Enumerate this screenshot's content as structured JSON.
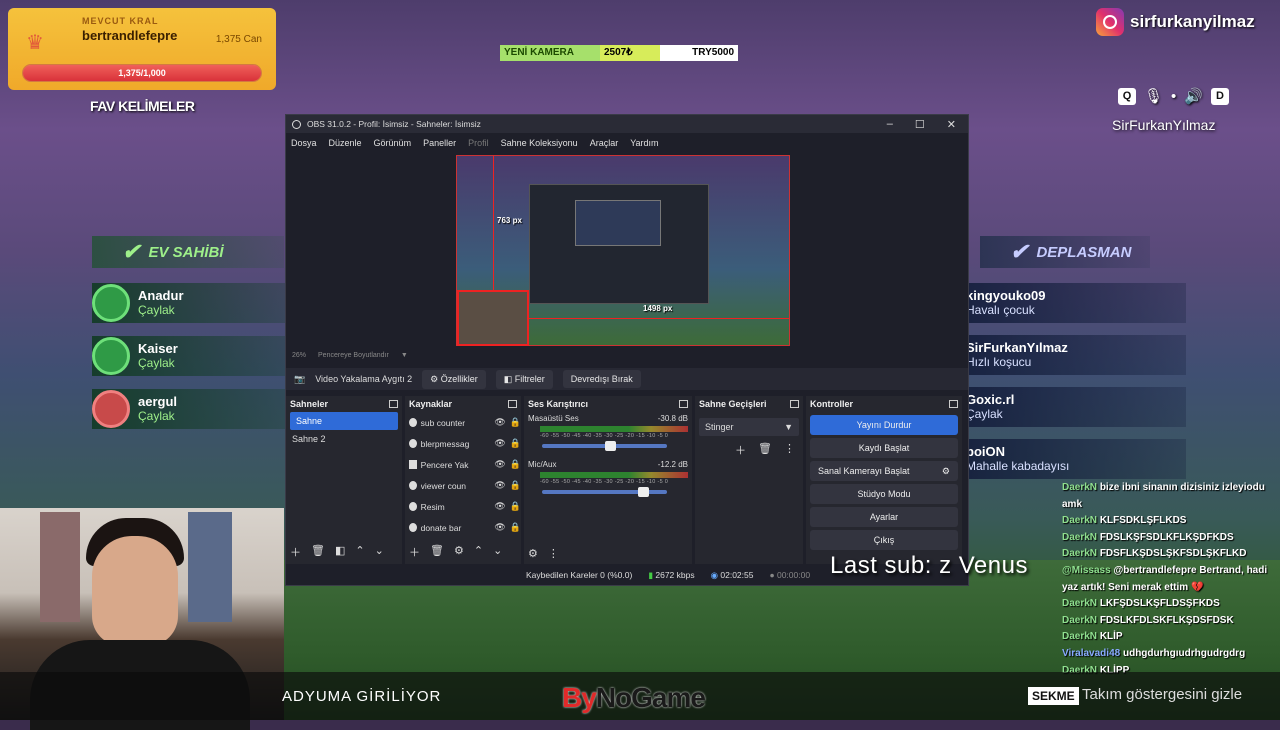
{
  "king": {
    "label": "MEVCUT KRAL",
    "name": "bertrandlefepre",
    "health": "1,375 Can",
    "progress_text": "1,375/1,000",
    "progress_fraction": 1.0
  },
  "fav_words": "FAV KELİMELER",
  "ticker": {
    "label": "YENİ KAMERA",
    "current": "2507₺",
    "target": "TRY5000"
  },
  "instagram": {
    "handle": "sirfurkanyilmaz",
    "icon": "instagram-icon"
  },
  "overlay_keys": [
    "Q",
    "D"
  ],
  "overlay_name": "SirFurkanYılmaz",
  "home_team": {
    "title": "EV SAHİBİ",
    "players": [
      {
        "name": "Anadur",
        "rank": "Çaylak"
      },
      {
        "name": "Kaiser",
        "rank": "Çaylak"
      },
      {
        "name": "aergul",
        "rank": "Çaylak"
      }
    ]
  },
  "away_team": {
    "title": "DEPLASMAN",
    "players": [
      {
        "name": "kingyouko09",
        "rank": "Havalı çocuk"
      },
      {
        "name": "SirFurkanYılmaz",
        "rank": "Hızlı koşucu"
      },
      {
        "name": "Goxic.rl",
        "rank": "Çaylak"
      },
      {
        "name": "boiON",
        "rank": "Mahalle kabadayısı"
      }
    ]
  },
  "obs": {
    "title": "OBS 31.0.2 - Profil: İsimsiz - Sahneler: İsimsiz",
    "menu": [
      "Dosya",
      "Düzenle",
      "Görünüm",
      "Paneller",
      "Profil",
      "Sahne Koleksiyonu",
      "Araçlar",
      "Yardım"
    ],
    "preview": {
      "width_label": "763 px",
      "height_label": "1498 px",
      "zoom": "26%",
      "fit": "Pencereye Boyutlandır"
    },
    "source_bar": {
      "source": "Video Yakalama Aygıtı 2",
      "props": "Özellikler",
      "filters": "Filtreler",
      "deactivate": "Devredışı Bırak"
    },
    "docks": {
      "scenes_title": "Sahneler",
      "scenes": [
        "Sahne",
        "Sahne 2"
      ],
      "sources_title": "Kaynaklar",
      "sources": [
        "sub counter",
        "blerpmessag",
        "Pencere Yak",
        "viewer coun",
        "Resim",
        "donate bar"
      ],
      "mixer_title": "Ses Karıştırıcı",
      "channels": [
        {
          "name": "Masaüstü Ses",
          "db": "-30.8 dB",
          "level": 0.55
        },
        {
          "name": "Mic/Aux",
          "db": "-12.2 dB",
          "level": 0.82
        }
      ],
      "meter_scale": "-60 -55 -50 -45 -40 -35 -30 -25 -20 -15 -10 -5 0",
      "transitions_title": "Sahne Geçişleri",
      "transition": "Stinger",
      "controls_title": "Kontroller",
      "controls": [
        "Yayını Durdur",
        "Kaydı Başlat",
        "Sanal Kamerayı Başlat",
        "Stüdyo Modu",
        "Ayarlar",
        "Çıkış"
      ]
    },
    "status": {
      "dropped": "Kaybedilen Kareler 0 (%0.0)",
      "bitrate": "2672 kbps",
      "live_time": "02:02:55",
      "rec_time": "00:00:00"
    }
  },
  "last_sub": "Last sub: z Venus",
  "chat": [
    {
      "user": "DaerkN",
      "msg": "bize ibni sinanın dizisiniz izleyiodu amk"
    },
    {
      "user": "DaerkN",
      "msg": "KLFSDKLŞFLKDS"
    },
    {
      "user": "DaerkN",
      "msg": "FDSLKŞFSDLKFLKŞDFKDS"
    },
    {
      "user": "DaerkN",
      "msg": "FDSFLKŞDSLŞKFSDLŞKFLKD"
    },
    {
      "user": "@Missass",
      "msg": "@bertrandlefepre Bertrand, hadi yaz artık! Seni merak ettim 💔"
    },
    {
      "user": "DaerkN",
      "msg": "LKFŞDSLKŞFLDSŞFKDS"
    },
    {
      "user": "DaerkN",
      "msg": "FDSLKFDLSKFLKŞDSFDSK"
    },
    {
      "user": "DaerkN",
      "msg": "KLİP"
    },
    {
      "user": "Viralavadi48",
      "msg": "udhgdurhgıudrhgudrgdrg"
    },
    {
      "user": "DaerkN",
      "msg": "KLİPP"
    }
  ],
  "bottom": {
    "stadium": "ADYUMA GİRİLİYOR",
    "logo_a": "By",
    "logo_b": "NoGame",
    "key": "SEKME",
    "hint": "Takım göstergesini gizle"
  }
}
